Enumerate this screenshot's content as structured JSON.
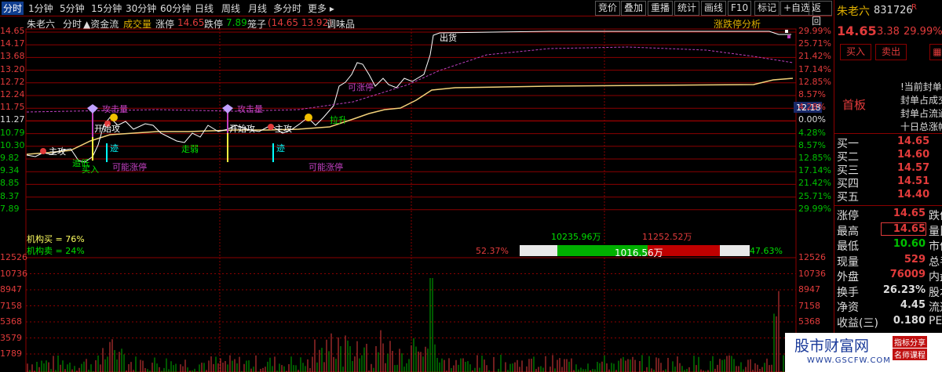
{
  "toolbar": {
    "tabs": [
      "分时",
      "1分钟",
      "5分钟",
      "15分钟",
      "30分钟",
      "60分钟",
      "日线",
      "周线",
      "月线",
      "多分时",
      "更多"
    ],
    "right_buttons": [
      "竞价",
      "叠加",
      "重播",
      "统计",
      "画线",
      "F10",
      "标记",
      "+自选",
      "返回"
    ]
  },
  "chart_header": {
    "name": "朱老六",
    "mode": "分时",
    "indicator": "▲资金流",
    "vol_label": "成交量",
    "limit_up_label": "涨停",
    "limit_up_value": "14.65",
    "limit_down_label": "跌停",
    "limit_down_value": "7.89",
    "cage_label": "笼子",
    "cage_value": "(14.65 13.92)",
    "sector": "调味品",
    "analysis": "涨跌停分析"
  },
  "y_left": [
    "14.65",
    "14.17",
    "13.68",
    "13.20",
    "12.72",
    "12.24",
    "11.75",
    "11.27",
    "10.79",
    "10.30",
    "9.82",
    "9.34",
    "8.85",
    "8.37",
    "7.89"
  ],
  "y_right": [
    "29.99%",
    "25.71%",
    "21.42%",
    "17.14%",
    "12.85%",
    "8.57%",
    "4.28%",
    "0.00%",
    "4.28%",
    "8.57%",
    "12.85%",
    "17.14%",
    "21.42%",
    "25.71%",
    "29.99%"
  ],
  "vol_axis_left": [
    "12526",
    "10736",
    "8947",
    "7158",
    "5368",
    "3579",
    "1789"
  ],
  "vol_axis_right": [
    "12526",
    "10736",
    "8947",
    "7158",
    "5368"
  ],
  "current_price_tag": "12.18",
  "annotations": {
    "zhugong": "主攻",
    "zhuidi": "追低",
    "mairu": "买入",
    "kaishi1": "开始攻",
    "gongji1": "攻击量",
    "kaishi2": "开始攻",
    "gongji2": "攻击量",
    "zhugong2": "主攻",
    "xin1": "迹",
    "xin2": "迹",
    "kenengzt1": "可能涨停",
    "kenengzt2": "可能涨停",
    "zhuanruo": "走弱",
    "lasheng": "拉升",
    "kezhangting": "可涨停",
    "chuhuo": "出货",
    "jiaoxian": "攻"
  },
  "org": {
    "buy": "机构买 = 76%",
    "sell": "机构卖 = 24%"
  },
  "capital": {
    "left_top": "10235.96万",
    "right_top": "11252.52万",
    "left_pct": "52.37%",
    "mid": "1016.56万",
    "right_pct": "47.63%"
  },
  "right_panel": {
    "name": "朱老六",
    "code": "831726",
    "flag": "R",
    "price": "14.65",
    "change": "3.38",
    "pct": "29.99%",
    "buy_btn": "买入",
    "sell_btn": "卖出",
    "first_board": "首板",
    "board_info": [
      "!当前封单额",
      "封单占成交",
      "封单占流通",
      "十日总涨幅"
    ],
    "bids": [
      {
        "label": "买一",
        "price": "14.65"
      },
      {
        "label": "买二",
        "price": "14.60"
      },
      {
        "label": "买三",
        "price": "14.57"
      },
      {
        "label": "买四",
        "price": "14.51"
      },
      {
        "label": "买五",
        "price": "14.40"
      }
    ],
    "stats": [
      {
        "label": "涨停",
        "value": "14.65",
        "extra": "跌停"
      },
      {
        "label": "最高",
        "value": "14.65",
        "extra": "量比"
      },
      {
        "label": "最低",
        "value": "10.60",
        "extra": "市值"
      },
      {
        "label": "现量",
        "value": "529",
        "extra": "总手"
      },
      {
        "label": "外盘",
        "value": "76009",
        "extra": "内盘"
      },
      {
        "label": "换手",
        "value": "26.23%",
        "extra": "股本"
      },
      {
        "label": "净资",
        "value": "4.45",
        "extra": "流通"
      },
      {
        "label": "收益(三)",
        "value": "0.180",
        "extra": "PE"
      }
    ]
  },
  "watermark": {
    "text": "股市财富网",
    "tag1": "指标分享",
    "tag2": "名师课程",
    "url": "WWW.GSCFW.COM"
  },
  "colors": {
    "up": "#e23b3b",
    "down": "#00c000",
    "price_line": "#ffffff",
    "avg_line": "#f3d27a",
    "grid": "#8b0000"
  }
}
